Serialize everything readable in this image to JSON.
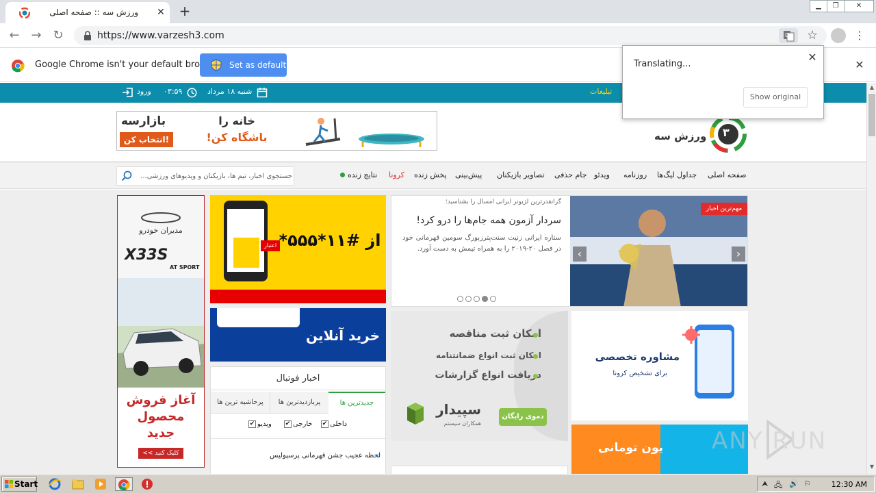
{
  "browser": {
    "tab_title": "ورزش سه :: صفحه اصلی",
    "url": "https://www.varzesh3.com",
    "infobar_message": "Google Chrome isn't your default browser",
    "set_default_label": "Set as default",
    "translate": {
      "status": "Translating...",
      "show_original_label": "Show original"
    }
  },
  "site": {
    "topbar": {
      "login_label": "ورود",
      "time": "۰۳:۵۹",
      "date": "شنبه ۱۸ مرداد",
      "ads_label": "تبلیغات"
    },
    "banner": {
      "brand": "بازارسه",
      "cta": "انتخاب کن!",
      "headline_line1": "خانه را",
      "headline_line2": "باشگاه کن!"
    },
    "logo_text": "ورزش سه",
    "search_placeholder": "جستجوی اخبار، تیم ها، بازیکنان و ویدیوهای ورزشی...",
    "nav": [
      "صفحه اصلی",
      "جداول لیگ‌ها",
      "روزنامه",
      "ویدئو",
      "جام حذفی",
      "تصاویر بازیکنان",
      "پیش‌بینی",
      "پخش زنده",
      "کرونا",
      "نتایج زنده"
    ],
    "featured": {
      "badge": "مهم‌ترین اخبار",
      "kicker": "گرانقدرترین لژیونر ایرانی امسال را بشناسید؛",
      "title": "سردار آزمون همه جام‌ها را درو کرد!",
      "body": "ستاره ایرانی زنیت سنت‌پترزبورگ سومین قهرمانی خود در فصل ۲۰-۲۰۱۹ را به همراه تیمش به دست آورد.",
      "slides_total": 5,
      "slides_active": 2
    },
    "left_ad": {
      "dealer": "مدیران خودرو",
      "model": "X33S",
      "model_sub": "AT SPORT",
      "line1": "آغاز فروش",
      "line2": "محصول",
      "line3": "جدید",
      "cta": "کلیک کنید >>"
    },
    "yellow_ad": {
      "code": "از #۱۱*۵۵۵*",
      "badge": "اعتبار"
    },
    "blue_ad": {
      "text": "خرید آنلاین"
    },
    "gray_ad": {
      "line1": "امکان ثبت مناقصه",
      "line2": "امکان ثبت انواع ضمانتنامه",
      "line3": "دریافت انواع گزارشات",
      "brand": "سپیدار",
      "brand_sub": "همکاران سیستم",
      "cta": "دموی رایگان"
    },
    "consult_ad": {
      "title": "مشاوره تخصصی",
      "subtitle": "برای تشخیص کرونا"
    },
    "orange_ad": {
      "text": "یون تومانی"
    },
    "football_news": {
      "title": "اخبار فوتبال",
      "tabs": [
        "جدیدترین ها",
        "پربازدیدترین ها",
        "پرحاشیه ترین ها"
      ],
      "filters": [
        "داخلی",
        "خارجی",
        "ویدیو"
      ],
      "items": [
        "لحظه عجیب جشن قهرمانی پرسپولیس"
      ]
    }
  },
  "taskbar": {
    "start_label": "Start",
    "clock": "12:30 AM"
  },
  "watermark": "ANY RUN",
  "colors": {
    "site_teal": "#0c8dab",
    "chrome_blue": "#4d8ef0",
    "ad_red": "#e42b2b",
    "ad_yellow": "#ffd200",
    "ad_blue": "#0b3f9c",
    "corona_red": "#d32f2f",
    "live_green": "#2e9e3e"
  }
}
